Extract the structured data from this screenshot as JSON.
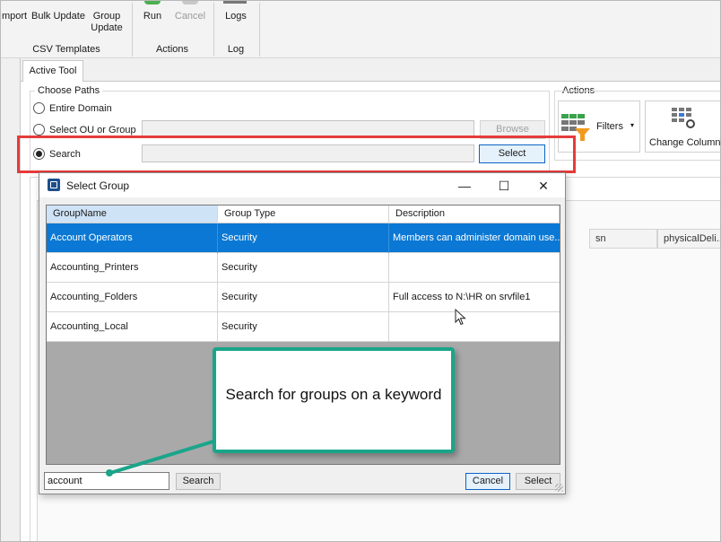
{
  "ribbon": {
    "buttons": {
      "import": "mport",
      "bulk_update": "Bulk Update",
      "group_update_1": "Group",
      "group_update_2": "Update",
      "run": "Run",
      "cancel": "Cancel",
      "logs": "Logs"
    },
    "groups": {
      "csv_templates": "CSV Templates",
      "actions": "Actions",
      "log": "Log"
    }
  },
  "tabs": {
    "active": "Active Tool"
  },
  "choose_paths": {
    "title": "Choose Paths",
    "entire_domain": "Entire Domain",
    "select_ou": "Select OU or Group",
    "search": "Search",
    "browse_label": "Browse",
    "select_label": "Select"
  },
  "actions_panel": {
    "title": "Actions",
    "filters": "Filters",
    "change_columns": "Change Columns"
  },
  "background_columns": {
    "sn": "sn",
    "physical": "physicalDeli..."
  },
  "dialog": {
    "title": "Select Group",
    "minimize": "—",
    "maximize": "☐",
    "close": "✕",
    "columns": [
      "GroupName",
      "Group Type",
      "Description"
    ],
    "rows": [
      {
        "name": "Account Operators",
        "type": "Security",
        "description": "Members can administer domain use..."
      },
      {
        "name": "Accounting_Printers",
        "type": "Security",
        "description": ""
      },
      {
        "name": "Accounting_Folders",
        "type": "Security",
        "description": "Full access to N:\\HR on srvfile1"
      },
      {
        "name": "Accounting_Local",
        "type": "Security",
        "description": ""
      }
    ],
    "selected_row": 0,
    "search_value": "account",
    "search_button": "Search",
    "cancel_button": "Cancel",
    "select_button": "Select"
  },
  "callout": {
    "text": "Search for groups on a keyword"
  },
  "colors": {
    "highlight_red": "#e63b3b",
    "callout_green": "#1aa58a",
    "selection_blue": "#0a78d4",
    "filter_orange": "#f39a1e"
  }
}
